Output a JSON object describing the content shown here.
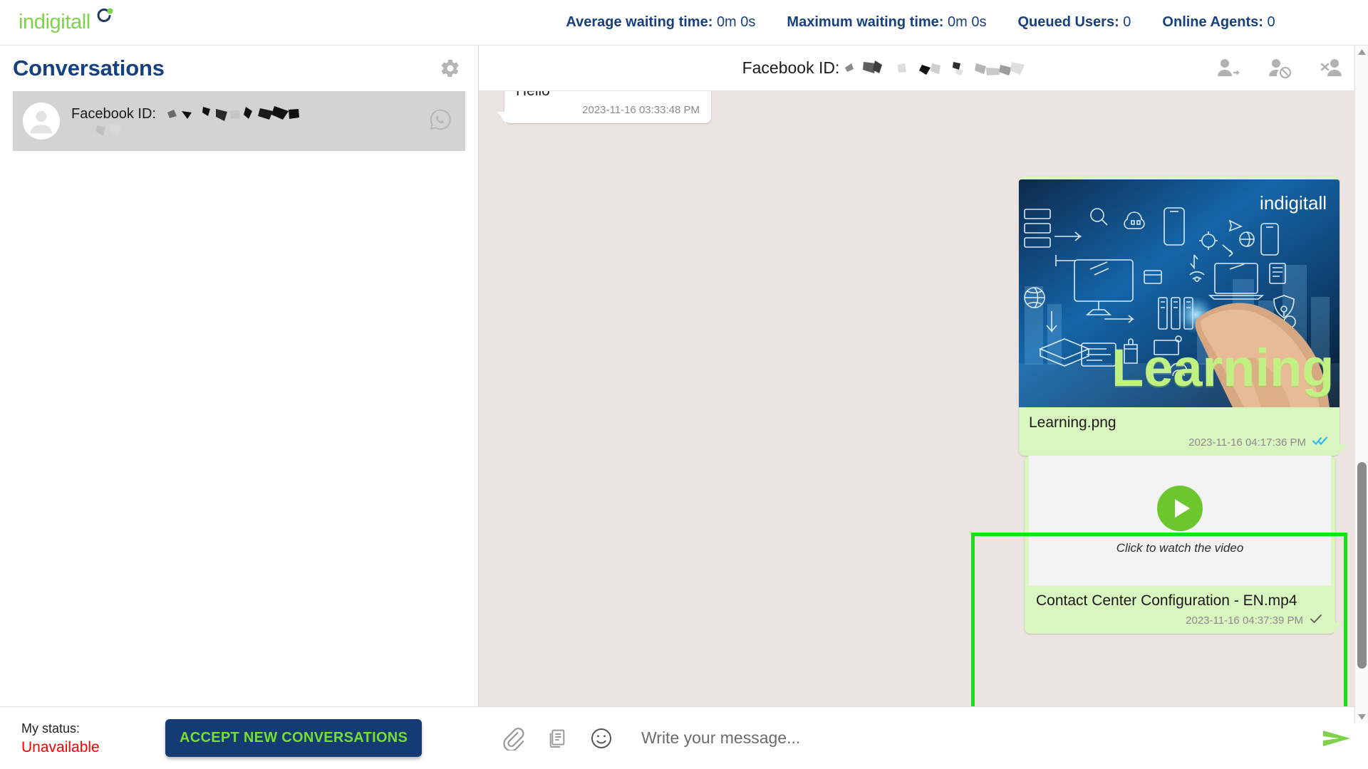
{
  "brand": {
    "name": "indigitall",
    "accent_green": "#7ED348",
    "mark_navy": "#1b3a63"
  },
  "stats": [
    {
      "key": "Average waiting time:",
      "value": "0m 0s",
      "name": "average-waiting-time"
    },
    {
      "key": "Maximum waiting time:",
      "value": "0m 0s",
      "name": "maximum-waiting-time"
    },
    {
      "key": "Queued Users:",
      "value": "0",
      "name": "queued-users"
    },
    {
      "key": "Online Agents:",
      "value": "0",
      "name": "online-agents"
    }
  ],
  "sidebar": {
    "title": "Conversations",
    "settings_icon": "gear-icon",
    "conversations": [
      {
        "label": "Facebook ID:",
        "id_redacted": true,
        "channel_icon": "whatsapp-icon",
        "avatar_icon": "person-avatar-icon",
        "selected": true
      }
    ]
  },
  "footer": {
    "status_label": "My status:",
    "status_value": "Unavailable",
    "status_color": "#ff0000",
    "accept_label": "ACCEPT NEW CONVERSATIONS",
    "accept_bg": "#143b73",
    "accept_fg": "#77dd33"
  },
  "chat": {
    "header": {
      "title": "Facebook ID:",
      "id_redacted": true,
      "actions": [
        {
          "name": "transfer-conversation-button",
          "icon": "person-arrow-icon"
        },
        {
          "name": "block-user-button",
          "icon": "person-block-icon"
        },
        {
          "name": "close-conversation-button",
          "icon": "person-remove-icon"
        }
      ]
    },
    "background": "#ece4e0",
    "messages": [
      {
        "id": "m1",
        "direction": "incoming",
        "type": "text",
        "text": "Hello",
        "timestamp": "2023-11-16 03:33:48 PM",
        "receipt": "none"
      },
      {
        "id": "m2",
        "direction": "outgoing",
        "type": "image",
        "filename": "Learning.png",
        "timestamp": "2023-11-16 04:17:36 PM",
        "receipt": "read-double-check-blue",
        "image_alt": "Digital technology icons with hand touching screen, indigitall logo, Learning text",
        "image_overlay_brand": "indigitall",
        "image_overlay_word": "Learning"
      },
      {
        "id": "m3",
        "direction": "outgoing",
        "type": "video",
        "filename": "Contact Center Configuration - EN.mp4",
        "hint": "Click to watch the video",
        "timestamp": "2023-11-16 04:37:39 PM",
        "receipt": "sent-single-check-gray",
        "highlighted": true,
        "highlight_color": "#18e018"
      }
    ]
  },
  "composer": {
    "placeholder": "Write your message...",
    "value": "",
    "tools": [
      {
        "name": "attach-file-button",
        "icon": "paperclip-icon"
      },
      {
        "name": "templates-button",
        "icon": "documents-icon"
      },
      {
        "name": "emoji-button",
        "icon": "smiley-icon"
      }
    ],
    "send": {
      "name": "send-message-button",
      "icon": "send-arrow-icon",
      "color": "#7ED348"
    }
  },
  "scrollbar": {
    "name": "chat-scrollbar",
    "position": "bottom"
  }
}
